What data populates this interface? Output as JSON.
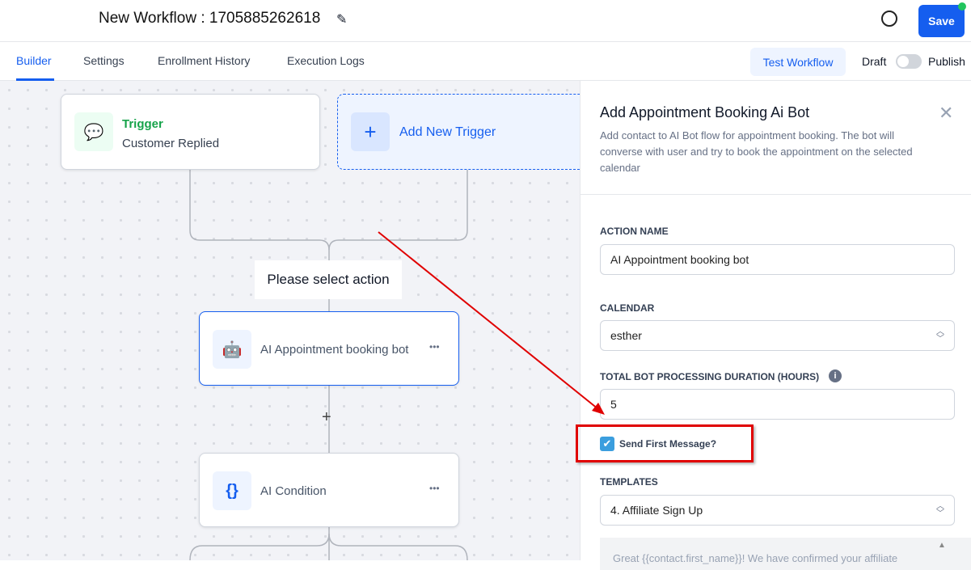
{
  "header": {
    "title": "New Workflow : 1705885262618",
    "save_label": "Save"
  },
  "tabs": [
    {
      "label": "Builder"
    },
    {
      "label": "Settings"
    },
    {
      "label": "Enrollment History"
    },
    {
      "label": "Execution Logs"
    }
  ],
  "toolbar": {
    "test_label": "Test Workflow",
    "draft_label": "Draft",
    "publish_label": "Publish",
    "published": false
  },
  "canvas": {
    "trigger": {
      "title": "Trigger",
      "subtitle": "Customer Replied"
    },
    "add_trigger": "Add New Trigger",
    "select_action": "Please select action",
    "nodes": [
      {
        "label": "AI Appointment booking bot",
        "icon": "robot-icon"
      },
      {
        "label": "AI Condition",
        "icon": "braces-icon"
      }
    ],
    "more": "•••",
    "plus": "+"
  },
  "panel": {
    "title": "Add Appointment Booking Ai Bot",
    "description": "Add contact to AI Bot flow for appointment booking. The bot will converse with user and try to book the appointment on the selected calendar",
    "action_name_label": "ACTION NAME",
    "action_name": "AI Appointment booking bot",
    "calendar_label": "CALENDAR",
    "calendar": "esther",
    "duration_label": "TOTAL BOT PROCESSING DURATION (HOURS)",
    "duration": "5",
    "send_first_label": "Send First Message?",
    "send_first": true,
    "templates_label": "TEMPLATES",
    "template": "4. Affiliate Sign Up",
    "message": "Great {{contact.first_name}}! We have confirmed your affiliate"
  },
  "colors": {
    "accent": "#155eef",
    "trigger": "#16a34a",
    "annotation": "#e00000"
  }
}
